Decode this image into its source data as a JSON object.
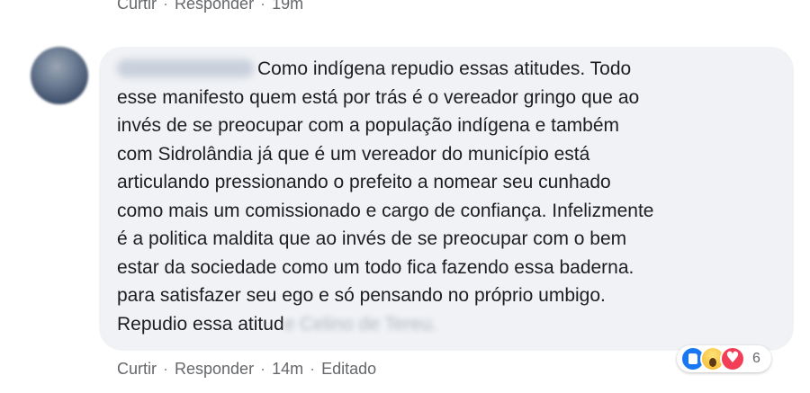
{
  "previous_comment": {
    "actions": {
      "like": "Curtir",
      "reply": "Responder",
      "time": "19m",
      "separator": "·"
    }
  },
  "comment": {
    "author": "",
    "lines": [
      "Como indígena repudio essas atitudes. Todo",
      "esse manifesto quem está por trás é o vereador gringo que ao",
      "invés de se preocupar com a população indígena e também",
      "com Sidrolândia já que é um vereador do município está",
      "articulando pressionando o prefeito a nomear seu cunhado",
      "como mais um comissionado e cargo de confiança. Infelizmente",
      "é a politica maldita que ao invés de se preocupar com o bem",
      "estar da sociedade como um todo fica fazendo essa baderna.",
      "para satisfazer seu ego e só pensando no próprio umbigo."
    ],
    "last_line_visible": "Repudio essa atitud",
    "last_line_blurred": "e Celino de Tereu.",
    "reactions": {
      "icons": [
        "like-icon",
        "wow-icon",
        "love-icon"
      ],
      "count": "6",
      "colors": {
        "like": "#1877f2",
        "wow": "#f7c340",
        "love": "#f33e58"
      }
    },
    "actions": {
      "like": "Curtir",
      "reply": "Responder",
      "time": "14m",
      "edited": "Editado",
      "separator": "·"
    }
  },
  "colors": {
    "bubble": "#f0f2f5",
    "text": "#1c1e21",
    "meta": "#65676b"
  }
}
